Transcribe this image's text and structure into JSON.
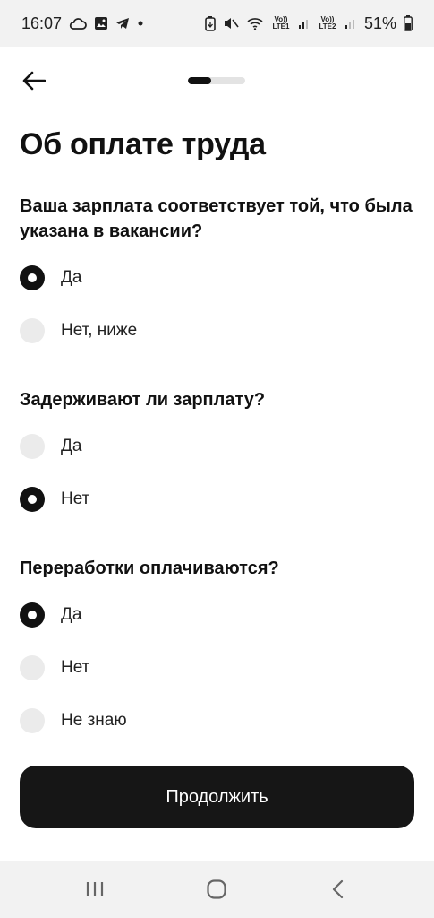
{
  "status_bar": {
    "time": "16:07",
    "battery_percent": "51%",
    "sim1_label": "Vo)) LTE1",
    "sim2_label": "Vo)) LTE2",
    "icons": [
      "cloud-icon",
      "gallery-icon",
      "telegram-icon",
      "dot-icon",
      "battery-saver-icon",
      "mute-icon",
      "wifi-icon",
      "signal-icon",
      "signal-icon",
      "battery-icon"
    ]
  },
  "header": {
    "back_icon": "arrow-left-icon",
    "progress_fraction": 0.4
  },
  "page": {
    "title": "Об оплате труда"
  },
  "questions": [
    {
      "text": "Ваша зарплата соответствует той, что была указана в вакансии?",
      "options": [
        {
          "label": "Да",
          "selected": true
        },
        {
          "label": "Нет, ниже",
          "selected": false
        }
      ]
    },
    {
      "text": "Задерживают ли зарплату?",
      "options": [
        {
          "label": "Да",
          "selected": false
        },
        {
          "label": "Нет",
          "selected": true
        }
      ]
    },
    {
      "text": "Переработки оплачиваются?",
      "options": [
        {
          "label": "Да",
          "selected": true
        },
        {
          "label": "Нет",
          "selected": false
        },
        {
          "label": "Не знаю",
          "selected": false
        }
      ]
    }
  ],
  "footer": {
    "continue_label": "Продолжить"
  },
  "nav_bar": {
    "icons": [
      "recent-apps-icon",
      "home-icon",
      "back-icon"
    ]
  }
}
